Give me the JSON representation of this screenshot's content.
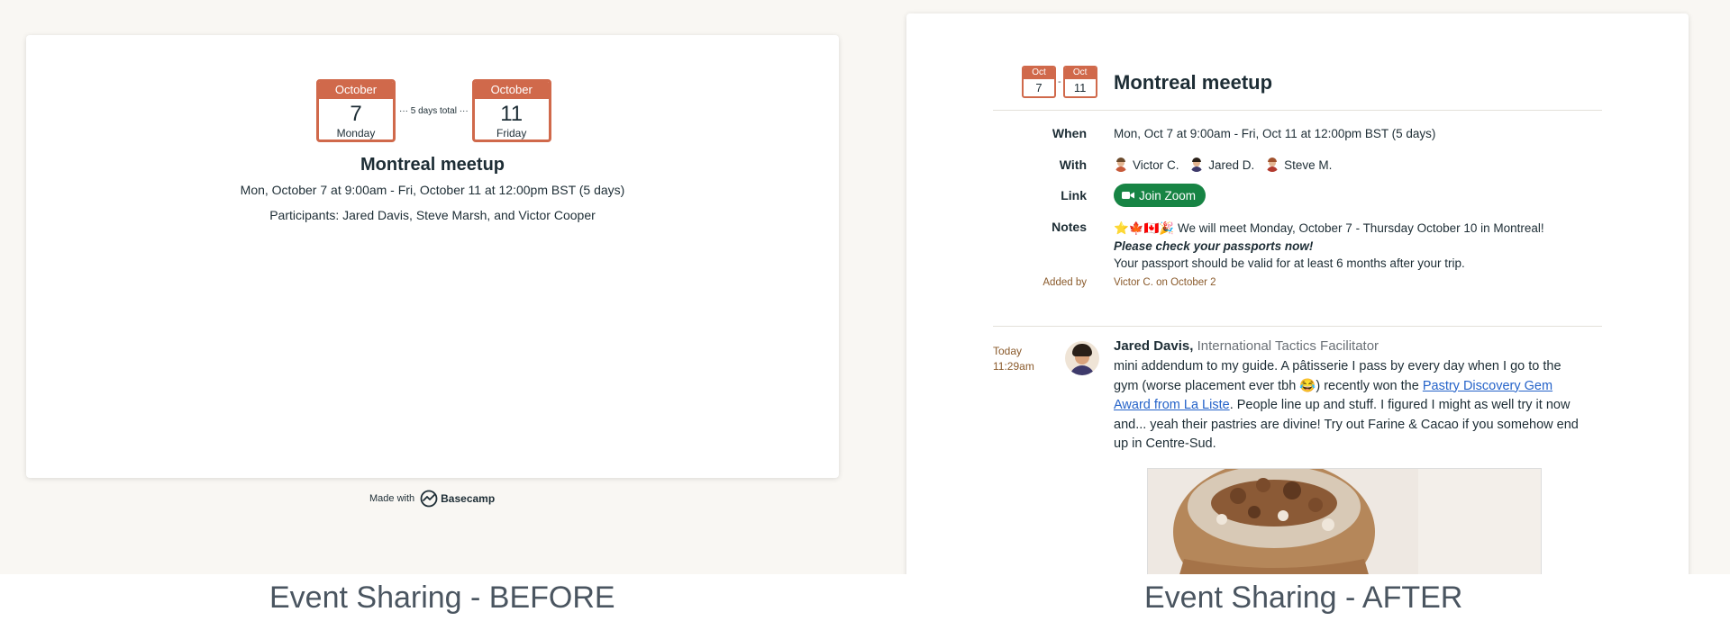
{
  "before": {
    "start": {
      "month": "October",
      "day": "7",
      "weekday": "Monday"
    },
    "end": {
      "month": "October",
      "day": "11",
      "weekday": "Friday"
    },
    "duration": "··· 5 days total ···",
    "title": "Montreal meetup",
    "when": "Mon, October 7 at 9:00am - Fri, October 11 at 12:00pm BST (5 days)",
    "participants": "Participants: Jared Davis, Steve Marsh, and Victor Cooper",
    "made_with": "Made with",
    "brand": "Basecamp"
  },
  "after": {
    "start": {
      "month": "Oct",
      "day": "7"
    },
    "end": {
      "month": "Oct",
      "day": "11"
    },
    "separator": "-",
    "title": "Montreal meetup",
    "when_label": "When",
    "when": "Mon, Oct 7 at 9:00am - Fri, Oct 11 at 12:00pm BST (5 days)",
    "with_label": "With",
    "people": [
      "Victor C.",
      "Jared D.",
      "Steve M."
    ],
    "link_label": "Link",
    "zoom_label": "Join Zoom",
    "notes_label": "Notes",
    "notes_line1": "⭐🍁🇨🇦🎉 We will meet Monday, October 7 - Thursday October 10 in Montreal!",
    "notes_line2": "Please check your passports now!",
    "notes_line3": "Your passport should be valid for at least 6 months after your trip.",
    "added_label": "Added by",
    "added_value": "Victor C. on October 2",
    "comment": {
      "time_line1": "Today",
      "time_line2": "11:29am",
      "author": "Jared Davis,",
      "role": "International Tactics Facilitator",
      "text_before": "mini addendum to my guide. A pâtisserie I pass by every day when I go to the gym (worse placement ever tbh 😂) recently won the ",
      "link_text": "Pastry Discovery Gem Award from La Liste",
      "text_after": ". People line up and stuff. I figured I might as well try it now and... yeah their pastries are divine! Try out Farine & Cacao if you somehow end up in Centre-Sud."
    }
  },
  "captions": {
    "before": "Event Sharing - BEFORE",
    "after": "Event Sharing - AFTER"
  },
  "colors": {
    "calendar_accent": "#d0694b",
    "zoom_green": "#178444",
    "meta_brown": "#8a5a2b",
    "link_blue": "#2563c9"
  }
}
